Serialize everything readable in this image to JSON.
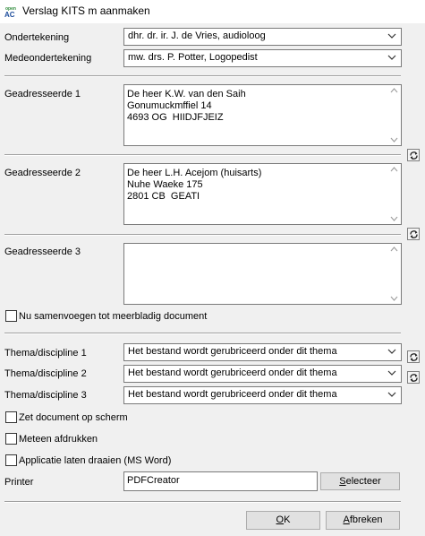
{
  "window": {
    "title": "Verslag KITS m aanmaken",
    "app_icon_text": "AC",
    "app_icon_small": "open"
  },
  "ondertekening": {
    "label": "Ondertekening",
    "value": "dhr. dr. ir. J. de Vries, audioloog"
  },
  "medeondertekening": {
    "label": "Medeondertekening",
    "value": "mw. drs. P. Potter, Logopedist"
  },
  "geadresseerden": [
    {
      "label": "Geadresseerde 1",
      "lines": "De heer K.W. van den Saih\nGonumuckmffiel 14\n4693 OG  HIIDJFJEIZ"
    },
    {
      "label": "Geadresseerde 2",
      "lines": "De heer L.H. Acejom (huisarts)\nNuhe Waeke 175\n2801 CB  GEATI"
    },
    {
      "label": "Geadresseerde 3",
      "lines": ""
    }
  ],
  "samenvoegen": {
    "label": "Nu samenvoegen tot meerbladig document",
    "checked": false
  },
  "themas": [
    {
      "label": "Thema/discipline 1",
      "value": "Het bestand wordt gerubriceerd onder dit thema"
    },
    {
      "label": "Thema/discipline 2",
      "value": "Het bestand wordt gerubriceerd onder dit thema"
    },
    {
      "label": "Thema/discipline 3",
      "value": "Het bestand wordt gerubriceerd onder dit thema"
    }
  ],
  "options": {
    "zet_op_scherm": {
      "label": "Zet document op scherm",
      "checked": false
    },
    "afdrukken": {
      "label": "Meteen afdrukken",
      "checked": false
    },
    "applicatie": {
      "label": "Applicatie laten draaien (MS Word)",
      "checked": false
    }
  },
  "printer": {
    "label": "Printer",
    "value": "PDFCreator",
    "select_button": {
      "prefix": "",
      "mnemonic": "S",
      "rest": "electeer"
    }
  },
  "buttons": {
    "ok": {
      "mnemonic": "O",
      "rest": "K"
    },
    "afbreken": {
      "mnemonic": "A",
      "rest": "fbreken"
    }
  },
  "colors": {
    "dialog_bg": "#f0f0f0",
    "titlebar_bg": "#ffffff",
    "icon_green": "#2e8b3a",
    "icon_blue": "#1f4e9c"
  },
  "icons": {
    "dropdown": "chevron-down-icon",
    "refresh": "refresh-icon",
    "scroll_up": "scroll-up-arrow-icon",
    "scroll_down": "scroll-down-arrow-icon"
  }
}
